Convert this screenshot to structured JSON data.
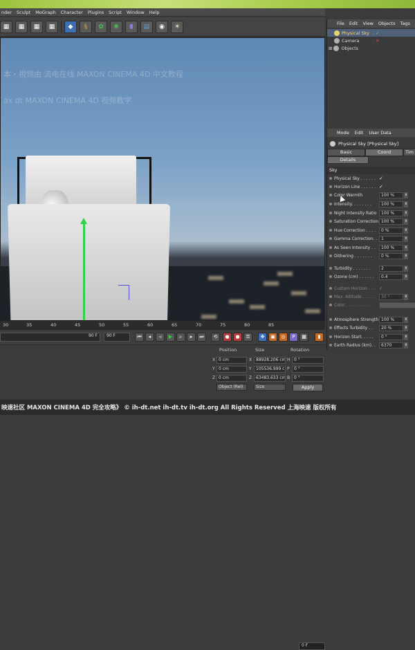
{
  "menubar": {
    "items": [
      "nder",
      "Sculpt",
      "MoGraph",
      "Character",
      "Plugins",
      "Script",
      "Window",
      "Help"
    ]
  },
  "viewport": {
    "watermark1": "本・視频由  流电在线 MAXON CINEMA 4D 中文教程",
    "watermark2": "ax  dt  MAXON CINEMA 4D 视频教学"
  },
  "timeline": {
    "ticks": [
      "30",
      "35",
      "40",
      "45",
      "50",
      "55",
      "60",
      "65",
      "70",
      "75",
      "80",
      "85"
    ],
    "frame_readout": "0 F",
    "frame_in": "90 F",
    "frame_out": "90 F"
  },
  "objects_manager": {
    "menu": [
      "File",
      "Edit",
      "View",
      "Objects",
      "Tags",
      "B"
    ],
    "items": [
      {
        "label": "Physical Sky",
        "color": "#e8d46a"
      },
      {
        "label": "Camera",
        "color": "#b0b0b0"
      },
      {
        "label": "Objects",
        "color": "#b0b0b0"
      }
    ]
  },
  "attributes": {
    "menu": [
      "Mode",
      "Edit",
      "User Data"
    ],
    "title": "Physical Sky [Physical Sky]",
    "tabs_row1": [
      "Basic",
      "Coord",
      "Tim"
    ],
    "tabs_row2": [
      "Details"
    ],
    "section": "Sky",
    "params": [
      {
        "label": "Physical Sky . . . . . .",
        "value": "✓",
        "type": "check"
      },
      {
        "label": "Horizon Line . . . . . .",
        "value": "✓",
        "type": "check"
      },
      {
        "label": "Color Warmth",
        "value": "100 %",
        "type": "num"
      },
      {
        "label": "Intensity. . . . . . . .",
        "value": "100 %",
        "type": "num"
      },
      {
        "label": "Night Intensity Ratio",
        "value": "100 %",
        "type": "num"
      },
      {
        "label": "Saturation Correction",
        "value": "100 %",
        "type": "num"
      },
      {
        "label": "Hue Correction . . . .",
        "value": "0 %",
        "type": "num"
      },
      {
        "label": "Gamma Correction. . .",
        "value": "1",
        "type": "num"
      },
      {
        "label": "As Seen Intensity . .",
        "value": "100 %",
        "type": "num"
      },
      {
        "label": "Dithering . . . . . . .",
        "value": "0 %",
        "type": "num"
      },
      {
        "label": "Turbidity . . . . . . .",
        "value": "2",
        "type": "num"
      },
      {
        "label": "Ozone (cm) . . . . . .",
        "value": "0.4",
        "type": "num"
      },
      {
        "label": "Custom Horizon . . .",
        "value": "✓",
        "type": "dimcheck"
      },
      {
        "label": "Max. Altitude . . . . .",
        "value": "30 °",
        "type": "dimnum"
      },
      {
        "label": "Color . . . . . . . . .",
        "value": "",
        "type": "dimcolor"
      },
      {
        "label": "Atmosphere Strength",
        "value": "100 %",
        "type": "num"
      },
      {
        "label": "Effects Turbidity . .",
        "value": "20 %",
        "type": "num"
      },
      {
        "label": "Horizon Start. . . . .",
        "value": "0 °",
        "type": "num"
      },
      {
        "label": "Earth Radius (km). .",
        "value": "6370",
        "type": "num"
      }
    ]
  },
  "coords": {
    "headers": {
      "position": "Position",
      "size": "Size",
      "rotation": "Rotation"
    },
    "rows": [
      {
        "axis": "X",
        "pos": "0 cm",
        "size_axis": "X",
        "size": "88928.206 cm",
        "rot_axis": "H",
        "rot": "0 °"
      },
      {
        "axis": "Y",
        "pos": "0 cm",
        "size_axis": "Y",
        "size": "105536.999 cm",
        "rot_axis": "P",
        "rot": "0 °"
      },
      {
        "axis": "Z",
        "pos": "0 cm",
        "size_axis": "Z",
        "size": "63483.633 cm",
        "rot_axis": "B",
        "rot": "0 °"
      }
    ],
    "mode_select": "Object (Rel)",
    "size_select": "Size",
    "apply_label": "Apply"
  },
  "footer": {
    "text": "映速社区 MAXON CINEMA 4D 完全攻略》  © ih-dt.net ih-dt.tv  ih-dt.org  All Rights Reserved 上海映速 版权所有"
  }
}
